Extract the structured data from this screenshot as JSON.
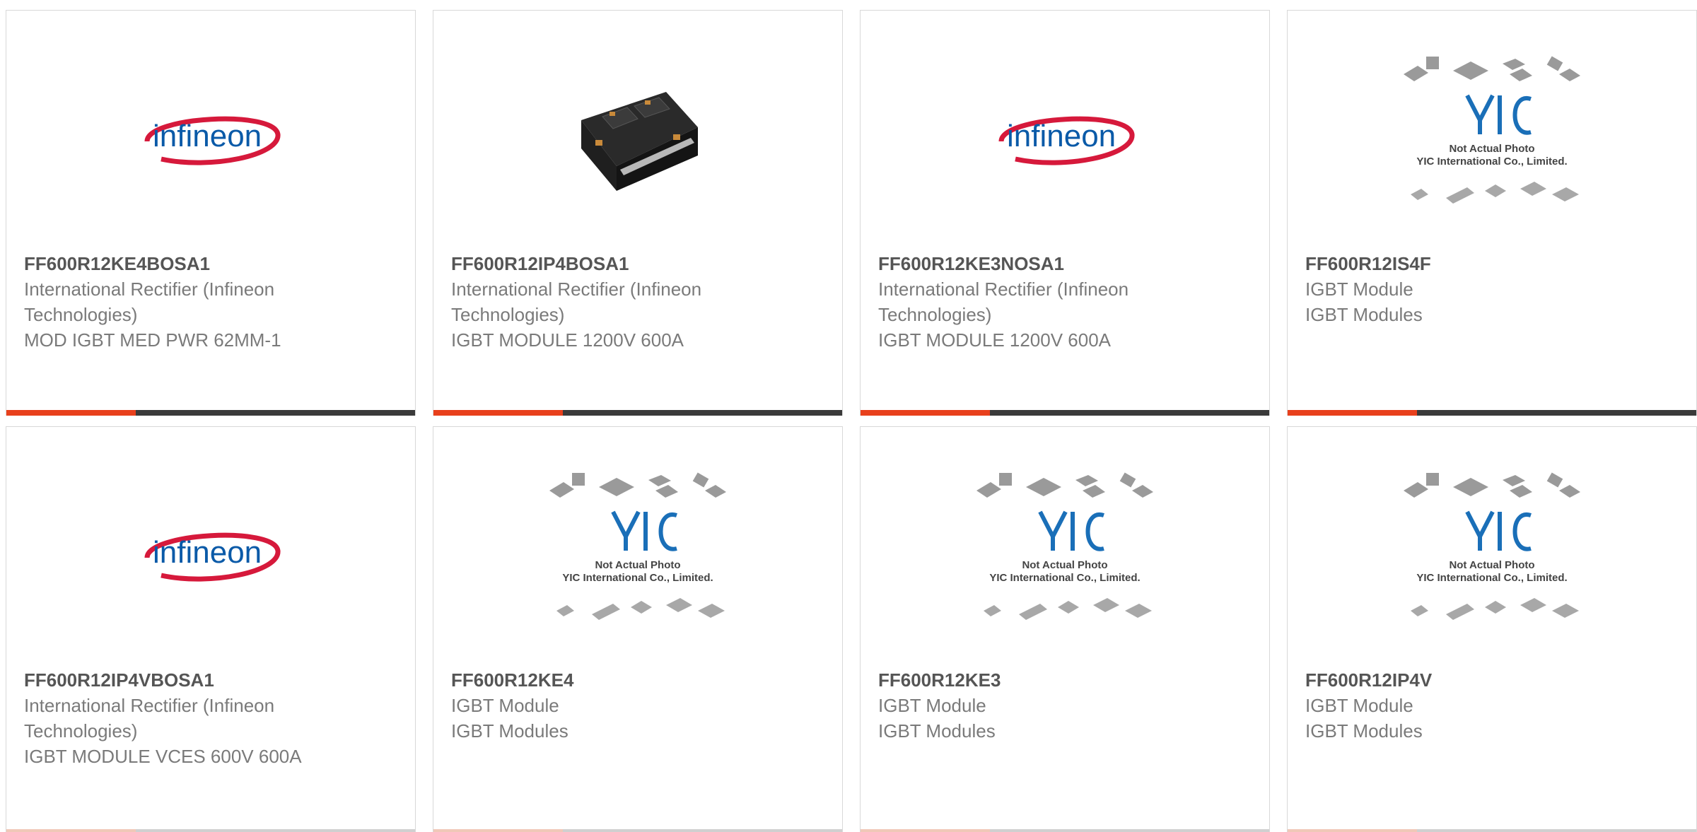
{
  "products": [
    {
      "part_number": "FF600R12KE4BOSA1",
      "manufacturer": "International Rectifier (Infineon Technologies)",
      "description": "MOD IGBT MED PWR 62MM-1",
      "image": "infineon-logo"
    },
    {
      "part_number": "FF600R12IP4BOSA1",
      "manufacturer": "International Rectifier (Infineon Technologies)",
      "description": "IGBT MODULE 1200V 600A",
      "image": "product-photo"
    },
    {
      "part_number": "FF600R12KE3NOSA1",
      "manufacturer": "International Rectifier (Infineon Technologies)",
      "description": "IGBT MODULE 1200V 600A",
      "image": "infineon-logo"
    },
    {
      "part_number": "FF600R12IS4F",
      "manufacturer": "IGBT Module",
      "description": "IGBT Modules",
      "image": "yic-placeholder"
    },
    {
      "part_number": "FF600R12IP4VBOSA1",
      "manufacturer": "International Rectifier (Infineon Technologies)",
      "description": "IGBT MODULE VCES 600V 600A",
      "image": "infineon-logo"
    },
    {
      "part_number": "FF600R12KE4",
      "manufacturer": "IGBT Module",
      "description": "IGBT Modules",
      "image": "yic-placeholder"
    },
    {
      "part_number": "FF600R12KE3",
      "manufacturer": "IGBT Module",
      "description": "IGBT Modules",
      "image": "yic-placeholder"
    },
    {
      "part_number": "FF600R12IP4V",
      "manufacturer": "IGBT Module",
      "description": "IGBT Modules",
      "image": "yic-placeholder"
    }
  ],
  "logo": {
    "infineon_text": "infineon"
  },
  "placeholder": {
    "brand": "YIC",
    "line1": "Not Actual Photo",
    "line2": "YIC International Co., Limited."
  },
  "colors": {
    "accent": "#e8401c",
    "bar": "#3a3a3a",
    "infineon_blue": "#0a5aa8",
    "infineon_red": "#d6193b",
    "yic_blue": "#1a6fb8"
  }
}
